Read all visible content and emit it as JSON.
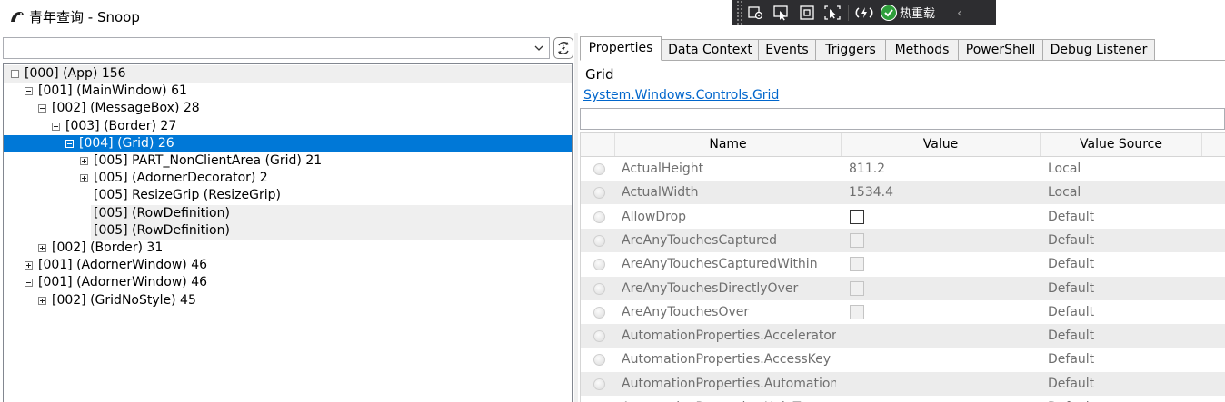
{
  "window": {
    "title": "青年查询 - Snoop"
  },
  "debug_toolbar": {
    "tools": [
      "select-element-icon",
      "cursor-select-icon",
      "display-adorners-icon",
      "track-focus-icon",
      "hot-reload-settings-icon"
    ],
    "hot_reload_label": "热重载",
    "collapse_label": "‹"
  },
  "tree": {
    "filter_value": "",
    "dropdown_glyph": "⌄",
    "nodes": [
      {
        "label": "[000]  (App) 156",
        "toggle": "minus"
      },
      {
        "label": "[001]  (MainWindow) 61",
        "toggle": "minus"
      },
      {
        "label": "[002]  (MessageBox) 28",
        "toggle": "minus"
      },
      {
        "label": "[003]  (Border) 27",
        "toggle": "minus"
      },
      {
        "label": "[004]  (Grid) 26",
        "toggle": "minus",
        "selected": true
      },
      {
        "label": "[005] PART_NonClientArea (Grid) 21",
        "toggle": "plus"
      },
      {
        "label": "[005]  (AdornerDecorator) 2",
        "toggle": "plus"
      },
      {
        "label": "[005] ResizeGrip (ResizeGrip)",
        "toggle": "none"
      },
      {
        "label": "[005]  (RowDefinition)",
        "toggle": "none"
      },
      {
        "label": "[005]  (RowDefinition)",
        "toggle": "none"
      },
      {
        "label": "[002]  (Border) 31",
        "toggle": "plus"
      },
      {
        "label": "[001]  (AdornerWindow) 46",
        "toggle": "plus"
      },
      {
        "label": "[001]  (AdornerWindow) 46",
        "toggle": "minus"
      },
      {
        "label": "[002]  (GridNoStyle) 45",
        "toggle": "plus"
      }
    ]
  },
  "tabs": [
    "Properties",
    "Data Context",
    "Events",
    "Triggers",
    "Methods",
    "PowerShell",
    "Debug Listener"
  ],
  "inspector": {
    "object_name": "Grid",
    "object_type": "System.Windows.Controls.Grid",
    "filter_value": ""
  },
  "property_grid": {
    "columns": [
      "Name",
      "Value",
      "Value Source"
    ],
    "rows": [
      {
        "name": "ActualHeight",
        "value": "811.2",
        "kind": "text",
        "source": "Local"
      },
      {
        "name": "ActualWidth",
        "value": "1534.4",
        "kind": "text",
        "source": "Local"
      },
      {
        "name": "AllowDrop",
        "value": "",
        "kind": "checkbox",
        "checked": false,
        "enabled": true,
        "source": "Default"
      },
      {
        "name": "AreAnyTouchesCaptured",
        "value": "",
        "kind": "checkbox",
        "checked": false,
        "enabled": false,
        "source": "Default"
      },
      {
        "name": "AreAnyTouchesCapturedWithin",
        "value": "",
        "kind": "checkbox",
        "checked": false,
        "enabled": false,
        "source": "Default"
      },
      {
        "name": "AreAnyTouchesDirectlyOver",
        "value": "",
        "kind": "checkbox",
        "checked": false,
        "enabled": false,
        "source": "Default"
      },
      {
        "name": "AreAnyTouchesOver",
        "value": "",
        "kind": "checkbox",
        "checked": false,
        "enabled": false,
        "source": "Default"
      },
      {
        "name": "AutomationProperties.AcceleratorKey",
        "value": "",
        "kind": "text",
        "source": "Default"
      },
      {
        "name": "AutomationProperties.AccessKey",
        "value": "",
        "kind": "text",
        "source": "Default"
      },
      {
        "name": "AutomationProperties.AutomationId",
        "value": "",
        "kind": "text",
        "source": "Default"
      },
      {
        "name": "AutomationProperties.HelpText",
        "value": "",
        "kind": "text",
        "source": "Default"
      }
    ]
  },
  "colors": {
    "selection": "#0078d7",
    "link": "#0066cc",
    "toolbar_bg": "#2d2d30",
    "hot_reload_ok": "#2e9e3a"
  }
}
